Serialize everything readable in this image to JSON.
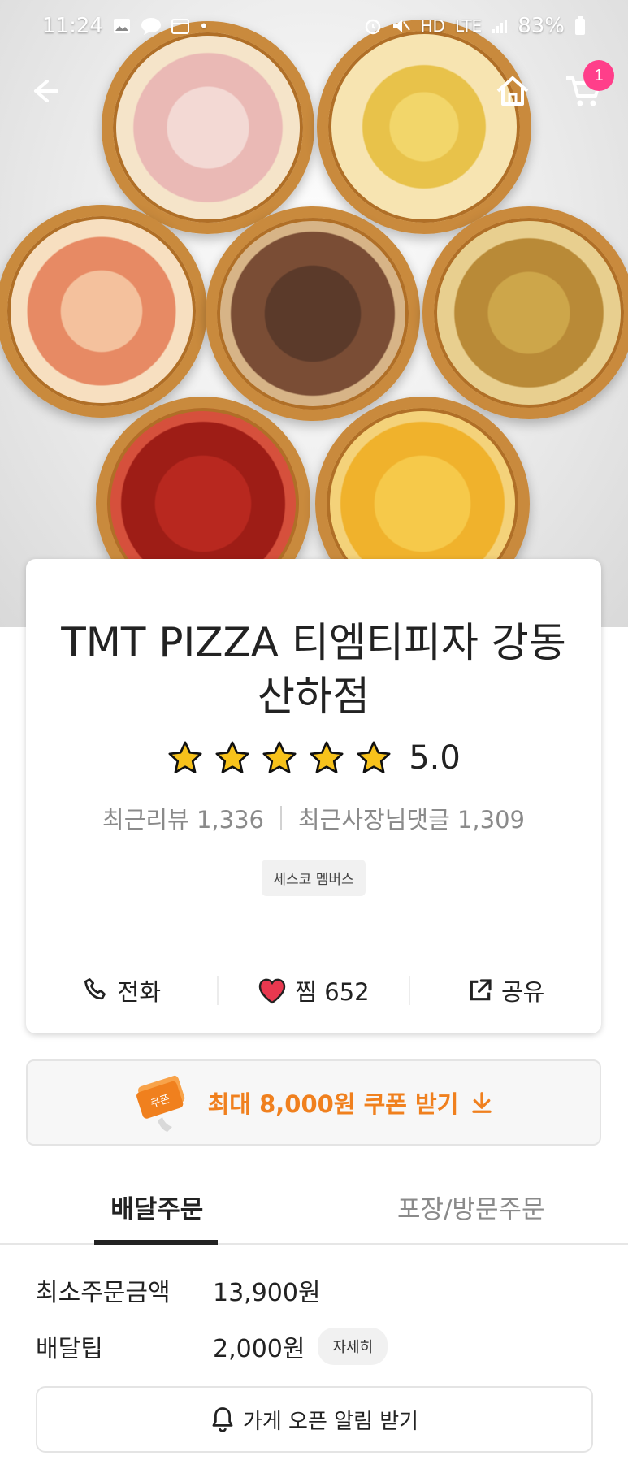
{
  "status_bar": {
    "time": "11:24",
    "left_icons": [
      "image-icon",
      "talk-icon",
      "calendar-icon",
      "dot-icon"
    ],
    "right_icons": [
      "alarm-icon",
      "mute-icon",
      "hd-icon",
      "lte-icon",
      "signal-icon",
      "battery-icon"
    ],
    "hd_label": "HD",
    "lte_label": "LTE",
    "battery": "83%"
  },
  "nav": {
    "cart_count": "1"
  },
  "store": {
    "name": "TMT PIZZA 티엠티피자 강동산하점",
    "rating": "5.0",
    "stars": 5,
    "recent_reviews_label": "최근리뷰 1,336",
    "owner_replies_label": "최근사장님댓글 1,309",
    "badge": "세스코 멤버스"
  },
  "actions": {
    "call": "전화",
    "like": "찜 652",
    "share": "공유"
  },
  "coupon": {
    "icon_text": "쿠폰",
    "label": "최대 8,000원 쿠폰 받기"
  },
  "tabs": [
    {
      "label": "배달주문",
      "active": true
    },
    {
      "label": "포장/방문주문",
      "active": false
    }
  ],
  "order_info": {
    "min_order_key": "최소주문금액",
    "min_order_value": "13,900원",
    "delivery_tip_key": "배달팁",
    "delivery_tip_value": "2,000원",
    "detail_button": "자세히",
    "notify_button": "가게 오픈 알림 받기"
  },
  "colors": {
    "accent": "#f0801e",
    "badge": "#ff3e8a",
    "heart": "#e8384f",
    "star": "#f7c21b"
  }
}
